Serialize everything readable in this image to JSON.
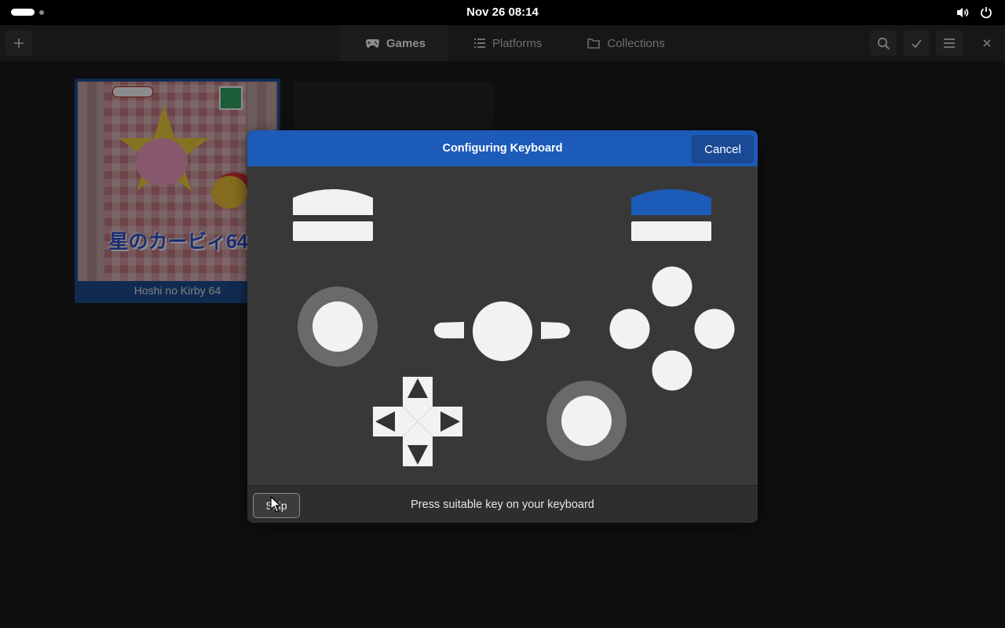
{
  "system_bar": {
    "clock": "Nov 26  08:14",
    "icons": [
      "activities-indicator",
      "volume-icon",
      "power-icon"
    ]
  },
  "header": {
    "add_icon": "plus-icon",
    "tabs": [
      {
        "label": "Games",
        "icon": "gamepad-icon",
        "active": true
      },
      {
        "label": "Platforms",
        "icon": "list-icon",
        "active": false
      },
      {
        "label": "Collections",
        "icon": "folder-icon",
        "active": false
      }
    ],
    "actions": [
      "search-icon",
      "check-icon",
      "hamburger-menu-icon",
      "close-icon"
    ]
  },
  "library": {
    "games": [
      {
        "title": "Hoshi no Kirby 64",
        "cover_text": "星のカービィ64",
        "selected": true
      }
    ]
  },
  "dialog": {
    "title": "Configuring Keyboard",
    "cancel_label": "Cancel",
    "skip_label": "Skip",
    "prompt": "Press suitable key on your keyboard",
    "highlighted_input": "right-shoulder-button",
    "colors": {
      "accent": "#1c5bb8",
      "button": "#f2f2f2",
      "stick_ring": "#6a6a6a"
    }
  }
}
